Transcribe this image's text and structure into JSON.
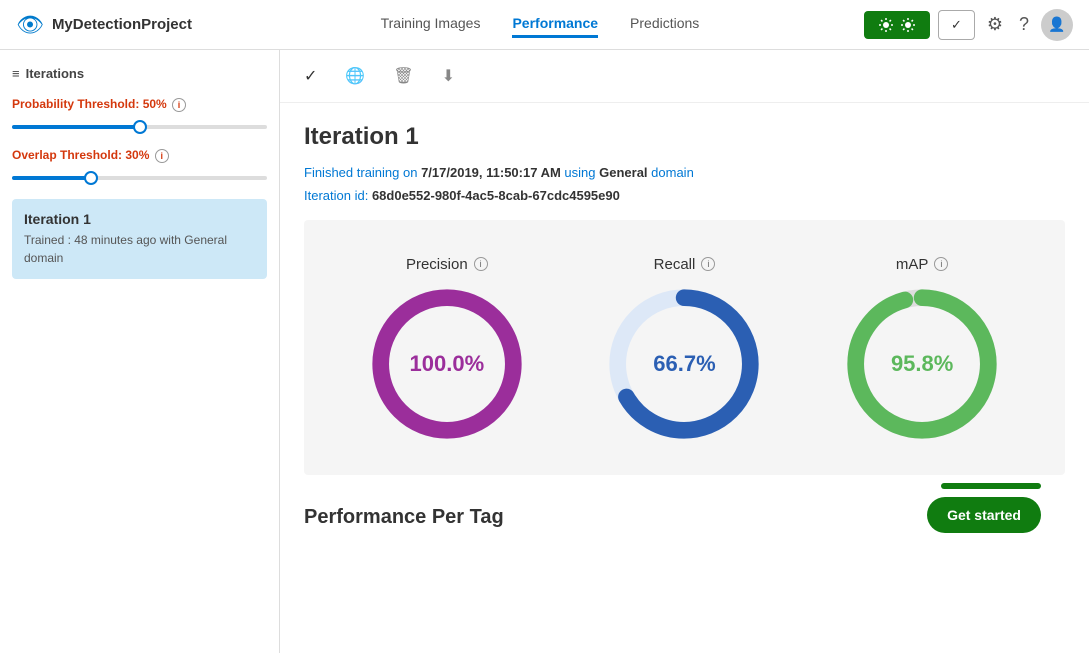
{
  "header": {
    "logo_icon": "👁",
    "project_name": "MyDetectionProject",
    "nav_tabs": [
      {
        "label": "Training Images",
        "active": false
      },
      {
        "label": "Performance",
        "active": true
      },
      {
        "label": "Predictions",
        "active": false
      }
    ],
    "btn_train_label": "⚙⚙",
    "btn_check_label": "✓",
    "settings_icon": "⚙",
    "help_icon": "?",
    "avatar_icon": "👤"
  },
  "sidebar": {
    "section_title": "Iterations",
    "probability_threshold_label": "Probability Threshold: ",
    "probability_threshold_value": "50%",
    "probability_threshold_pct": 50,
    "overlap_threshold_label": "Overlap Threshold: ",
    "overlap_threshold_value": "30%",
    "overlap_threshold_pct": 30,
    "iteration": {
      "title": "Iteration 1",
      "subtitle": "Trained : 48 minutes ago with General domain"
    }
  },
  "toolbar": {
    "check_icon": "✓",
    "globe_icon": "🌐",
    "trash_icon": "🗑",
    "download_icon": "⬇"
  },
  "iteration_detail": {
    "title": "Iteration 1",
    "meta_line1_pre": "Finished training on ",
    "meta_date": "7/17/2019, 11:50:17 AM",
    "meta_line1_mid": " using ",
    "meta_domain": "General",
    "meta_line1_post": " domain",
    "meta_line2_pre": "Iteration id: ",
    "meta_id": "68d0e552-980f-4ac5-8cab-67cdc4595e90"
  },
  "charts": {
    "precision": {
      "label": "Precision",
      "value": "100.0%",
      "pct": 100,
      "color": "#9b2e9b"
    },
    "recall": {
      "label": "Recall",
      "value": "66.7%",
      "pct": 66.7,
      "color": "#2b5fb3"
    },
    "map": {
      "label": "mAP",
      "value": "95.8%",
      "pct": 95.8,
      "color": "#5cb85c"
    }
  },
  "performance_per_tag_label": "Performance Per Tag",
  "get_started_label": "Get started"
}
